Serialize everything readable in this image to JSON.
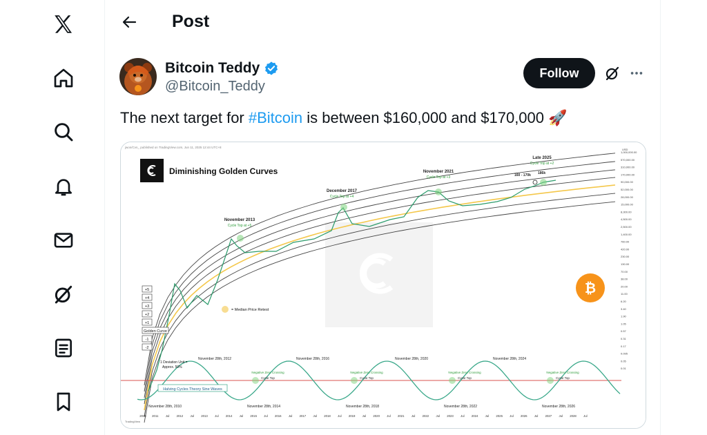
{
  "nav": {
    "items": [
      {
        "name": "x-logo-icon"
      },
      {
        "name": "home-icon"
      },
      {
        "name": "explore-search-icon"
      },
      {
        "name": "notifications-bell-icon"
      },
      {
        "name": "messages-mail-icon"
      },
      {
        "name": "grok-icon"
      },
      {
        "name": "lists-icon"
      },
      {
        "name": "bookmarks-icon"
      }
    ]
  },
  "header": {
    "title": "Post"
  },
  "post": {
    "author_name": "Bitcoin Teddy",
    "author_handle": "@Bitcoin_Teddy",
    "follow_label": "Follow",
    "text_before": "The next target for ",
    "hashtag": "#Bitcoin",
    "text_after": " is between $160,000 and $170,000 ",
    "emoji": "🚀"
  },
  "chart_data": {
    "type": "line",
    "title": "Diminishing Golden Curves",
    "attribution": "jwon/Cvn_ published on TradingView.com, Jun 11, 2025 12:44 UTC+8",
    "annotations": [
      {
        "label": "November 2013",
        "sub": "Cycle Top at +5"
      },
      {
        "label": "December 2017",
        "sub": "Cycle Top at +4"
      },
      {
        "label": "November 2021",
        "sub": "Cycle Top at +3"
      },
      {
        "label": "Late 2025",
        "sub": "Cycle Top at +2"
      },
      {
        "label": "160 - 170k"
      },
      {
        "label": "186k"
      }
    ],
    "deviation_labels": [
      "+5",
      "+4",
      "+3",
      "+2",
      "+1",
      "Golden Curve",
      "-1",
      "-2"
    ],
    "deviation_note": [
      "1 Deviation Unit =",
      "Approx. 50%"
    ],
    "legend_note": "= Median Price Retest",
    "sine_label": "Halving Cycles Theory Sine Waves",
    "sine_peaks": [
      "November 28th, 2012",
      "November 28th, 2016",
      "November 28th, 2020",
      "November 28th, 2024"
    ],
    "sine_troughs": [
      "November 28th, 2010",
      "November 28th, 2014",
      "November 28th, 2018",
      "November 28th, 2022",
      "November 28th, 2026"
    ],
    "zero_cross_labels": [
      "Negative Zero Crossing",
      "Cycle Top"
    ],
    "x_ticks": [
      "2010",
      "2011",
      "Jul",
      "2012",
      "Jul",
      "2013",
      "Jul",
      "2014",
      "Jul",
      "2015",
      "Jul",
      "2016",
      "Jul",
      "2017",
      "Jul",
      "2018",
      "Jul",
      "2019",
      "Jul",
      "2020",
      "Jul",
      "2021",
      "Jul",
      "2022",
      "Jul",
      "2023",
      "Jul",
      "2024",
      "Jul",
      "2025",
      "Jul",
      "2026",
      "Jul",
      "2027",
      "Jul",
      "2028",
      "Jul"
    ],
    "y_ticks": [
      "1,000,000.00",
      "570,000.00",
      "310,000.00",
      "170,000.00",
      "90,000.00",
      "52,000.00",
      "28,000.00",
      "15,000.00",
      "8,300.00",
      "4,500.00",
      "2,500.00",
      "1,400.00",
      "760.00",
      "420.00",
      "230.00",
      "130.00",
      "70.00",
      "38.00",
      "20.00",
      "11.00",
      "6.20",
      "3.40",
      "1.90",
      "1.05",
      "0.57",
      "0.31",
      "0.17",
      "0.095",
      "0.05",
      "0.01"
    ],
    "y_unit": "USD",
    "y_scale": "log",
    "watermark": "TradingView"
  }
}
